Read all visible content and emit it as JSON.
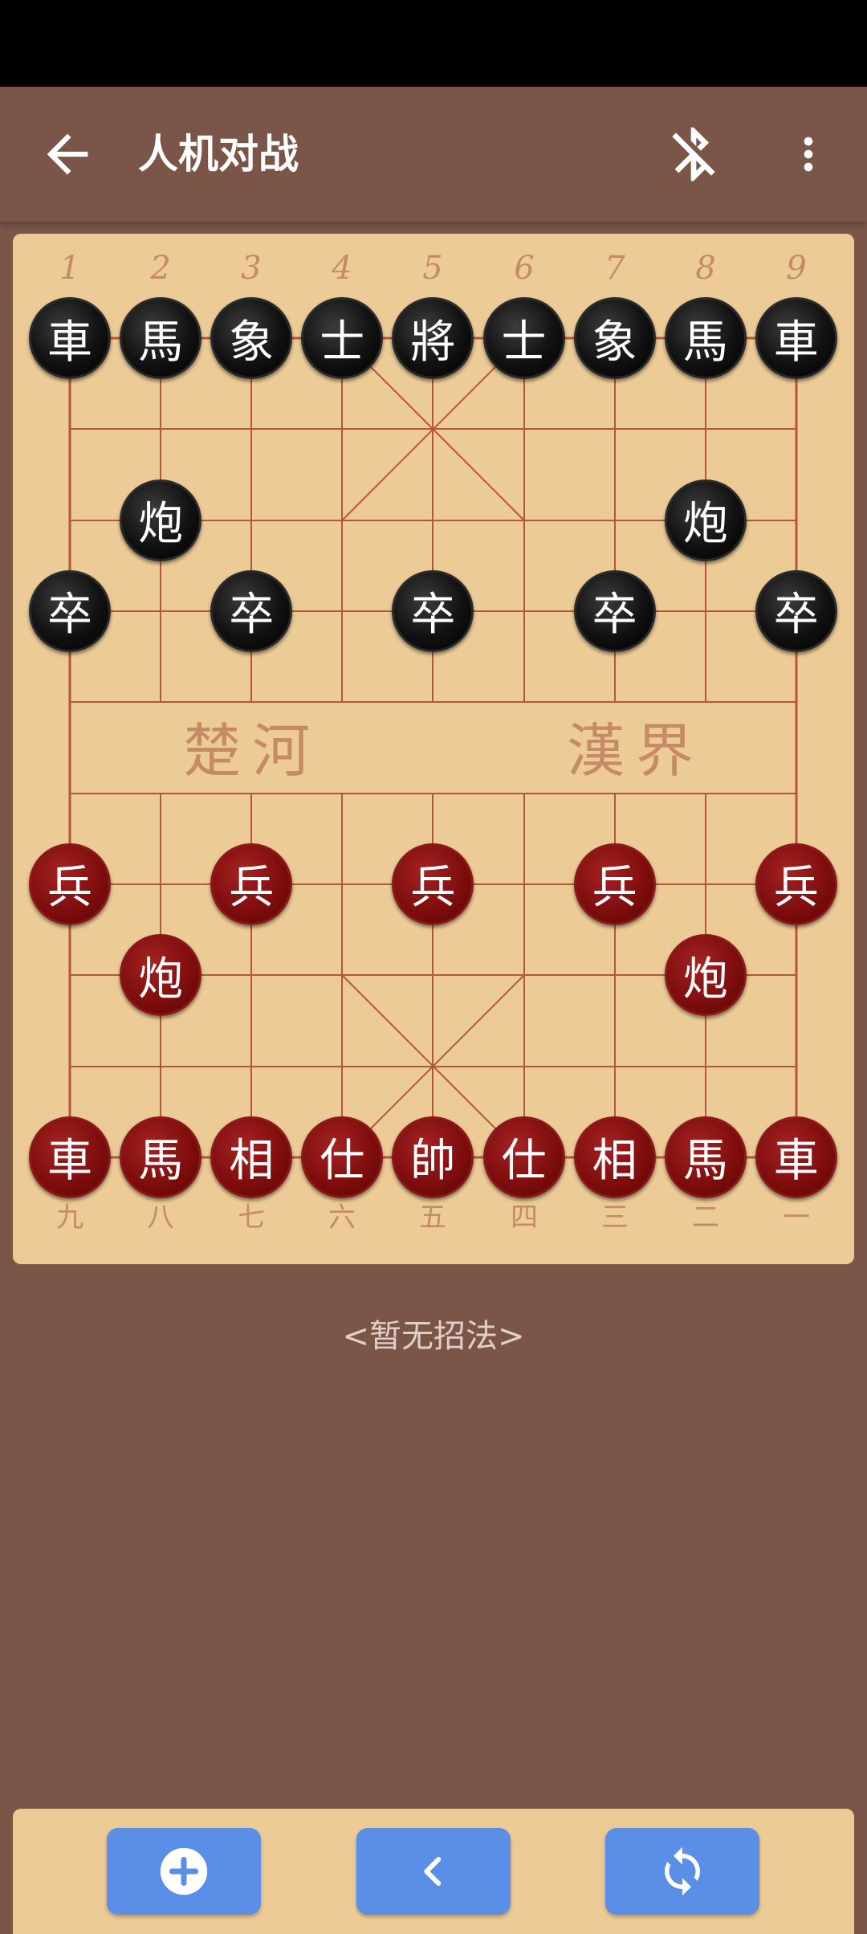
{
  "app_bar": {
    "title": "人机对战"
  },
  "board": {
    "top_coordinates": [
      "1",
      "2",
      "3",
      "4",
      "5",
      "6",
      "7",
      "8",
      "9"
    ],
    "bottom_coordinates": [
      "九",
      "八",
      "七",
      "六",
      "五",
      "四",
      "三",
      "二",
      "一"
    ],
    "river_left": "楚河",
    "river_right": "漢界"
  },
  "pieces": {
    "black": [
      {
        "char": "車",
        "file": 1,
        "rank": 0
      },
      {
        "char": "馬",
        "file": 2,
        "rank": 0
      },
      {
        "char": "象",
        "file": 3,
        "rank": 0
      },
      {
        "char": "士",
        "file": 4,
        "rank": 0
      },
      {
        "char": "將",
        "file": 5,
        "rank": 0
      },
      {
        "char": "士",
        "file": 6,
        "rank": 0
      },
      {
        "char": "象",
        "file": 7,
        "rank": 0
      },
      {
        "char": "馬",
        "file": 8,
        "rank": 0
      },
      {
        "char": "車",
        "file": 9,
        "rank": 0
      },
      {
        "char": "炮",
        "file": 2,
        "rank": 2
      },
      {
        "char": "炮",
        "file": 8,
        "rank": 2
      },
      {
        "char": "卒",
        "file": 1,
        "rank": 3
      },
      {
        "char": "卒",
        "file": 3,
        "rank": 3
      },
      {
        "char": "卒",
        "file": 5,
        "rank": 3
      },
      {
        "char": "卒",
        "file": 7,
        "rank": 3
      },
      {
        "char": "卒",
        "file": 9,
        "rank": 3
      }
    ],
    "red": [
      {
        "char": "兵",
        "file": 1,
        "rank": 6
      },
      {
        "char": "兵",
        "file": 3,
        "rank": 6
      },
      {
        "char": "兵",
        "file": 5,
        "rank": 6
      },
      {
        "char": "兵",
        "file": 7,
        "rank": 6
      },
      {
        "char": "兵",
        "file": 9,
        "rank": 6
      },
      {
        "char": "炮",
        "file": 2,
        "rank": 7
      },
      {
        "char": "炮",
        "file": 8,
        "rank": 7
      },
      {
        "char": "車",
        "file": 1,
        "rank": 9
      },
      {
        "char": "馬",
        "file": 2,
        "rank": 9
      },
      {
        "char": "相",
        "file": 3,
        "rank": 9
      },
      {
        "char": "仕",
        "file": 4,
        "rank": 9
      },
      {
        "char": "帥",
        "file": 5,
        "rank": 9
      },
      {
        "char": "仕",
        "file": 6,
        "rank": 9
      },
      {
        "char": "相",
        "file": 7,
        "rank": 9
      },
      {
        "char": "馬",
        "file": 8,
        "rank": 9
      },
      {
        "char": "車",
        "file": 9,
        "rank": 9
      }
    ]
  },
  "move_history": {
    "text": "<暂无招法>"
  },
  "icons": {
    "back": "back-arrow-icon",
    "bluetooth": "bluetooth-disabled-icon",
    "menu": "more-vert-icon",
    "new_game": "add-circle-icon",
    "undo": "chevron-left-icon",
    "flip": "sync-icon"
  },
  "colors": {
    "background": "#7a5548",
    "board": "#eccb96",
    "grid_line": "#b5553f",
    "red_piece": "#7c0c0c",
    "black_piece": "#111111",
    "button": "#5b8ee6"
  }
}
